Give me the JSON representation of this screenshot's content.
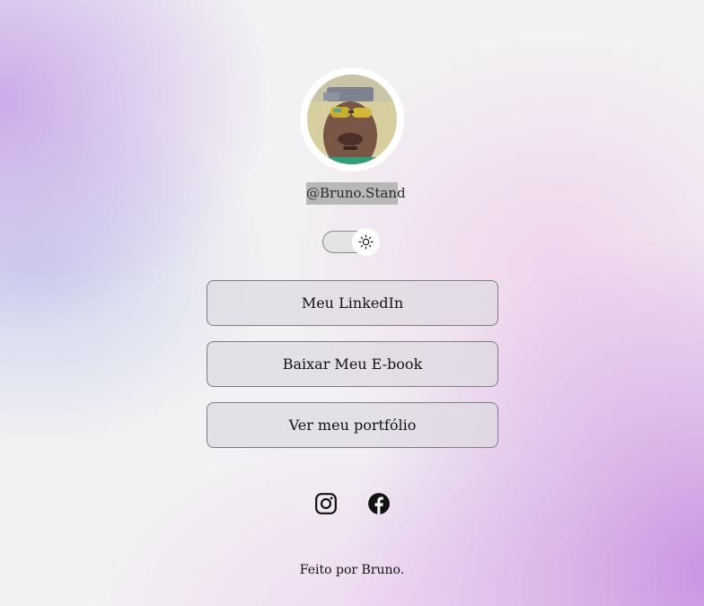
{
  "profile": {
    "username": "@Bruno.Stand",
    "avatar_alt": "avatar"
  },
  "theme_toggle": {
    "icon": "sun-icon",
    "state": "light"
  },
  "links": [
    {
      "label": "Meu LinkedIn"
    },
    {
      "label": "Baixar Meu E-book"
    },
    {
      "label": "Ver meu portfólio"
    }
  ],
  "social": [
    {
      "icon": "instagram-icon"
    },
    {
      "icon": "facebook-icon"
    }
  ],
  "footer": {
    "text": "Feito por Bruno."
  },
  "colors": {
    "button_border": "#7d7d82",
    "button_bg": "#dedae2",
    "text": "#111111",
    "username_highlight": "#b8b8b8",
    "gradient_purple": "#c8a0e8"
  }
}
